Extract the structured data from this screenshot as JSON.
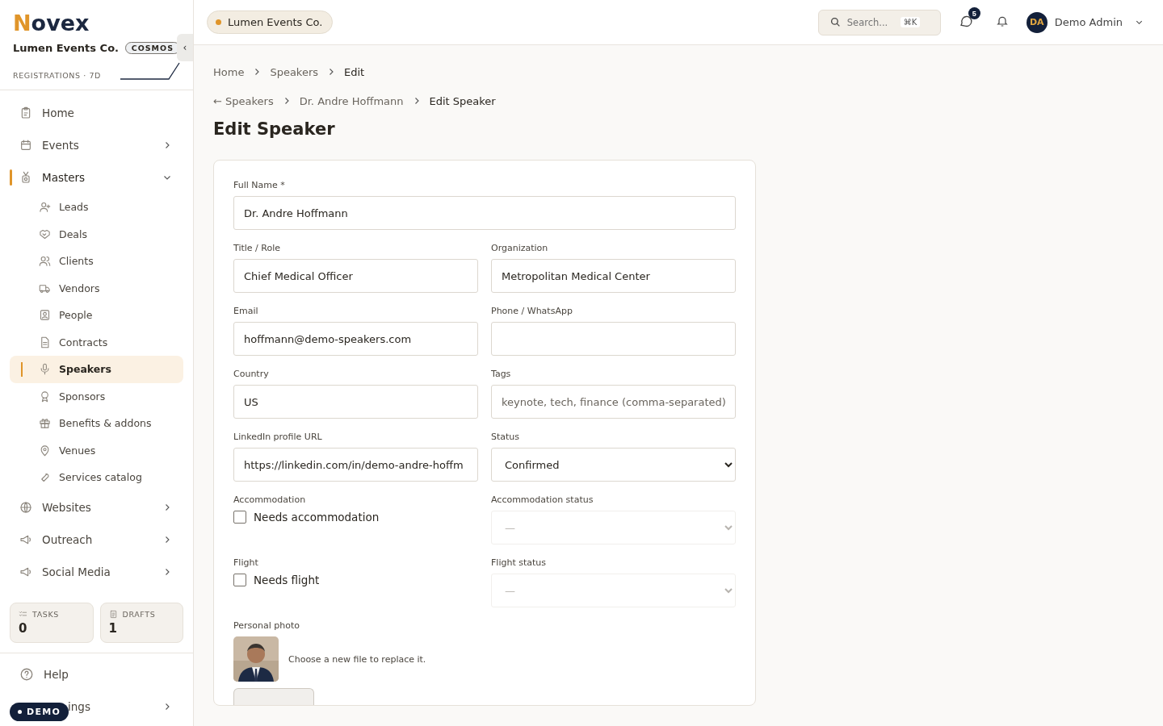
{
  "sidebar": {
    "logo": {
      "mark": "N",
      "text": "ovex"
    },
    "org": {
      "name": "Lumen Events Co.",
      "plan": "COSMOS"
    },
    "registrations_label": "REGISTRATIONS · 7D",
    "collapse_glyph": "‹",
    "nav": [
      {
        "label": "Home",
        "selected": false,
        "has_children": false
      },
      {
        "label": "Events",
        "selected": false,
        "expanded": false,
        "has_children": true
      },
      {
        "label": "Masters",
        "selected": true,
        "expanded": true,
        "has_children": true,
        "children": [
          {
            "label": "Leads",
            "selected": false
          },
          {
            "label": "Deals",
            "selected": false
          },
          {
            "label": "Clients",
            "selected": false
          },
          {
            "label": "Vendors",
            "selected": false
          },
          {
            "label": "People",
            "selected": false
          },
          {
            "label": "Contracts",
            "selected": false
          },
          {
            "label": "Speakers",
            "selected": true
          },
          {
            "label": "Sponsors",
            "selected": false
          },
          {
            "label": "Benefits & addons",
            "selected": false
          },
          {
            "label": "Venues",
            "selected": false
          },
          {
            "label": "Services catalog",
            "selected": false
          }
        ]
      },
      {
        "label": "Websites",
        "selected": false,
        "expanded": false,
        "has_children": true
      },
      {
        "label": "Outreach",
        "selected": false,
        "expanded": false,
        "has_children": true
      },
      {
        "label": "Social Media",
        "selected": false,
        "expanded": false,
        "has_children": true
      }
    ],
    "counters": [
      {
        "label": "TASKS",
        "value": "0"
      },
      {
        "label": "DRAFTS",
        "value": "1"
      }
    ],
    "footer": [
      {
        "label": "Help",
        "has_children": false
      },
      {
        "label": "ings",
        "has_children": true
      }
    ],
    "demo_badge": "DEMO"
  },
  "topbar": {
    "org_chip": "Lumen Events Co.",
    "search": {
      "placeholder": "Search...",
      "shortcut": "⌘K"
    },
    "messages_count": "5",
    "user": {
      "initials": "DA",
      "name": "Demo Admin"
    }
  },
  "breadcrumb": [
    "Home",
    "Speakers",
    "Edit"
  ],
  "back_trail": {
    "arrow": "←",
    "back": "Speakers",
    "items": [
      "Dr. Andre Hoffmann",
      "Edit Speaker"
    ]
  },
  "page_title": "Edit Speaker",
  "form": {
    "full_name": {
      "label": "Full Name *",
      "value": "Dr. Andre Hoffmann"
    },
    "fields": [
      {
        "kind": "text",
        "label": "Title / Role",
        "value": "Chief Medical Officer"
      },
      {
        "kind": "text",
        "label": "Organization",
        "value": "Metropolitan Medical Center"
      },
      {
        "kind": "text",
        "label": "Email",
        "value": "hoffmann@demo-speakers.com"
      },
      {
        "kind": "text",
        "label": "Phone / WhatsApp"
      },
      {
        "kind": "text",
        "label": "Country",
        "value": "US"
      },
      {
        "kind": "text",
        "label": "Tags",
        "placeholder": "keynote, tech, finance (comma-separated)"
      },
      {
        "kind": "text",
        "label": "LinkedIn profile URL",
        "value": "https://linkedin.com/in/demo-andre-hoffm"
      },
      {
        "kind": "select",
        "label": "Status",
        "value": "Confirmed",
        "disabled": false
      },
      {
        "kind": "checkbox",
        "label": "Accommodation",
        "text": "Needs accommodation",
        "checked": false
      },
      {
        "kind": "select",
        "label": "Accommodation status",
        "value": "—",
        "disabled": true
      },
      {
        "kind": "checkbox",
        "label": "Flight",
        "text": "Needs flight",
        "checked": false
      },
      {
        "kind": "select",
        "label": "Flight status",
        "value": "—",
        "disabled": true
      }
    ],
    "photo": {
      "label": "Personal photo",
      "hint": "Choose a new file to replace it."
    }
  }
}
